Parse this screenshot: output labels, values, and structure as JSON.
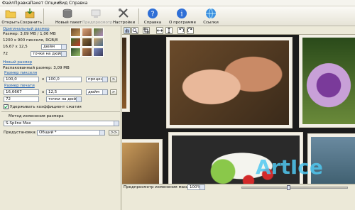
{
  "menu": [
    "Файл",
    "Правка",
    "Пакет",
    "Опции",
    "Вид",
    "Справка"
  ],
  "toolbar": {
    "open": "Открыть",
    "save": "Сохранить",
    "new_batch": "Новый пакет",
    "preview": "Предпросмотр",
    "settings": "Настройки",
    "help": "Справка",
    "about": "О программе",
    "links": "Ссылки"
  },
  "original": {
    "heading": "Оригинальный размер",
    "size_line": "Размер: 3,09 MB / 1,06 MB",
    "pixels_line": "1200 x 900 пикселя, RGB/8",
    "print_size": "16,67 x 12,5",
    "print_unit": "дюйм",
    "dpi": "72",
    "dpi_unit": "точки на дюйм"
  },
  "new": {
    "heading": "Новый размер",
    "unpacked": "Распакованный размер: 3,09 MB",
    "pixel_heading": "Размер пикселя",
    "pixel_w": "100,0",
    "pixel_h": "100,0",
    "pixel_unit": "процент",
    "print_heading": "Размер печати",
    "print_w": "16,6667",
    "print_h": "12,5",
    "print_unit": "дюйм",
    "dpi": "72",
    "dpi_unit": "точки на дюйм",
    "x": "x",
    "more": ">",
    "keep_ratio": "Удерживать коэффициент сжатия"
  },
  "method": {
    "heading": "Метод изменения размера",
    "value": "S-Spline Max",
    "preset_label": "Предустановка:",
    "preset_value": "Общий *",
    "more": ">>"
  },
  "status": {
    "label": "Предпросмотр изменения масштаба:",
    "zoom": "100%"
  },
  "watermark": "ArtIce"
}
